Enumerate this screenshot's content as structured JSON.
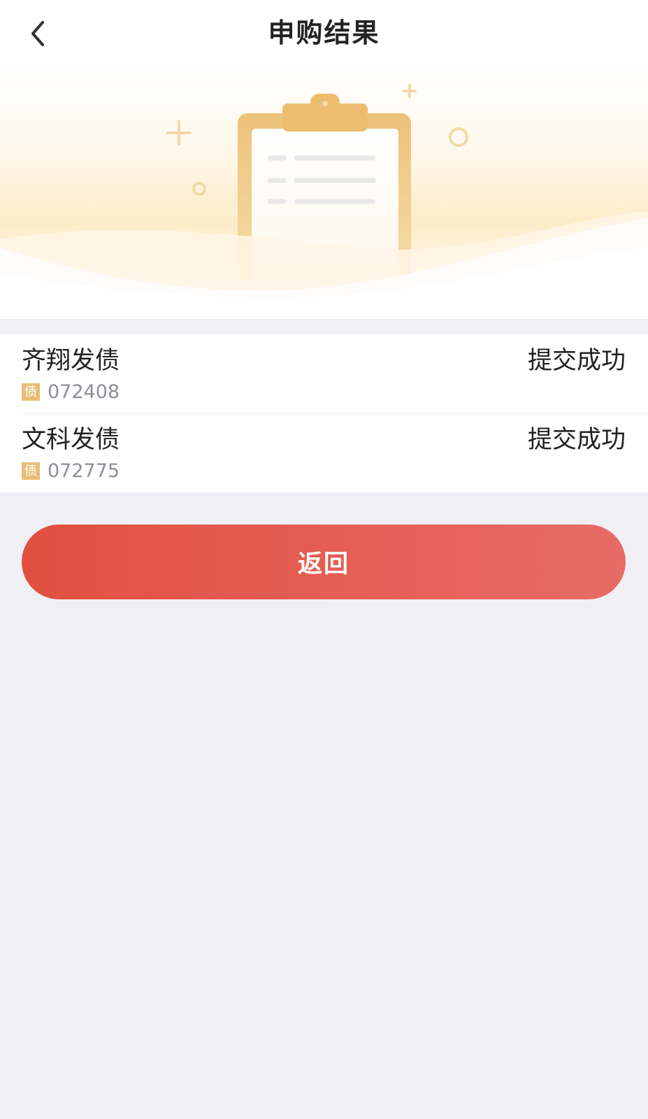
{
  "header": {
    "title": "申购结果",
    "back_icon": "chevron-left-icon"
  },
  "hero": {
    "illustration_icon": "clipboard-icon"
  },
  "results": [
    {
      "name": "齐翔发债",
      "badge": "债",
      "code": "072408",
      "status": "提交成功"
    },
    {
      "name": "文科发债",
      "badge": "债",
      "code": "072775",
      "status": "提交成功"
    }
  ],
  "actions": {
    "return_label": "返回"
  },
  "colors": {
    "accent_gold": "#e9bd76",
    "button_start": "#e15041",
    "button_end": "#e86b66",
    "page_background": "#f0eff4"
  }
}
